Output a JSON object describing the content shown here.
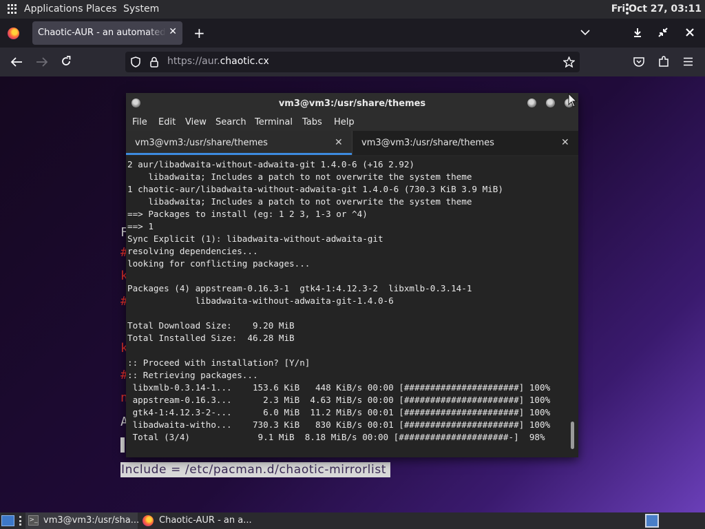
{
  "top_panel": {
    "menus": [
      "Applications",
      "Places",
      "System"
    ],
    "clock": "Fri Oct 27, 03:11"
  },
  "browser": {
    "tab_title": "Chaotic-AUR - an automated bu",
    "url_prefix": "https://aur.",
    "url_domain": "chaotic.cx"
  },
  "page_background": {
    "letters": [
      "F",
      "#",
      "k",
      "#",
      "k",
      "#",
      "n",
      "A",
      "["
    ],
    "highlight_line": "Include = /etc/pacman.d/chaotic-mirrorlist"
  },
  "terminal": {
    "title": "vm3@vm3:/usr/share/themes",
    "menu": [
      "File",
      "Edit",
      "View",
      "Search",
      "Terminal",
      "Tabs",
      "Help"
    ],
    "tabs": [
      {
        "label": "vm3@vm3:/usr/share/themes",
        "active": true
      },
      {
        "label": "vm3@vm3:/usr/share/themes",
        "active": false
      }
    ],
    "output": [
      "2 aur/libadwaita-without-adwaita-git 1.4.0-6 (+16 2.92)",
      "    libadwaita; Includes a patch to not overwrite the system theme",
      "1 chaotic-aur/libadwaita-without-adwaita-git 1.4.0-6 (730.3 KiB 3.9 MiB)",
      "    libadwaita; Includes a patch to not overwrite the system theme",
      "==> Packages to install (eg: 1 2 3, 1-3 or ^4)",
      "==> 1",
      "Sync Explicit (1): libadwaita-without-adwaita-git",
      "resolving dependencies...",
      "looking for conflicting packages...",
      "",
      "Packages (4) appstream-0.16.3-1  gtk4-1:4.12.3-2  libxmlb-0.3.14-1",
      "             libadwaita-without-adwaita-git-1.4.0-6",
      "",
      "Total Download Size:    9.20 MiB",
      "Total Installed Size:  46.28 MiB",
      "",
      ":: Proceed with installation? [Y/n]",
      ":: Retrieving packages...",
      " libxmlb-0.3.14-1...    153.6 KiB   448 KiB/s 00:00 [######################] 100%",
      " appstream-0.16.3...      2.3 MiB  4.63 MiB/s 00:00 [######################] 100%",
      " gtk4-1:4.12.3-2-...      6.0 MiB  11.2 MiB/s 00:01 [######################] 100%",
      " libadwaita-witho...    730.3 KiB   830 KiB/s 00:01 [######################] 100%",
      " Total (3/4)             9.1 MiB  8.18 MiB/s 00:00 [#####################-]  98%"
    ]
  },
  "taskbar": {
    "items": [
      "vm3@vm3:/usr/sha...",
      "Chaotic-AUR - an a..."
    ]
  },
  "colors": {
    "accent_tab_underline": "#3d8be0",
    "page_red_letters": "#e0302a"
  }
}
